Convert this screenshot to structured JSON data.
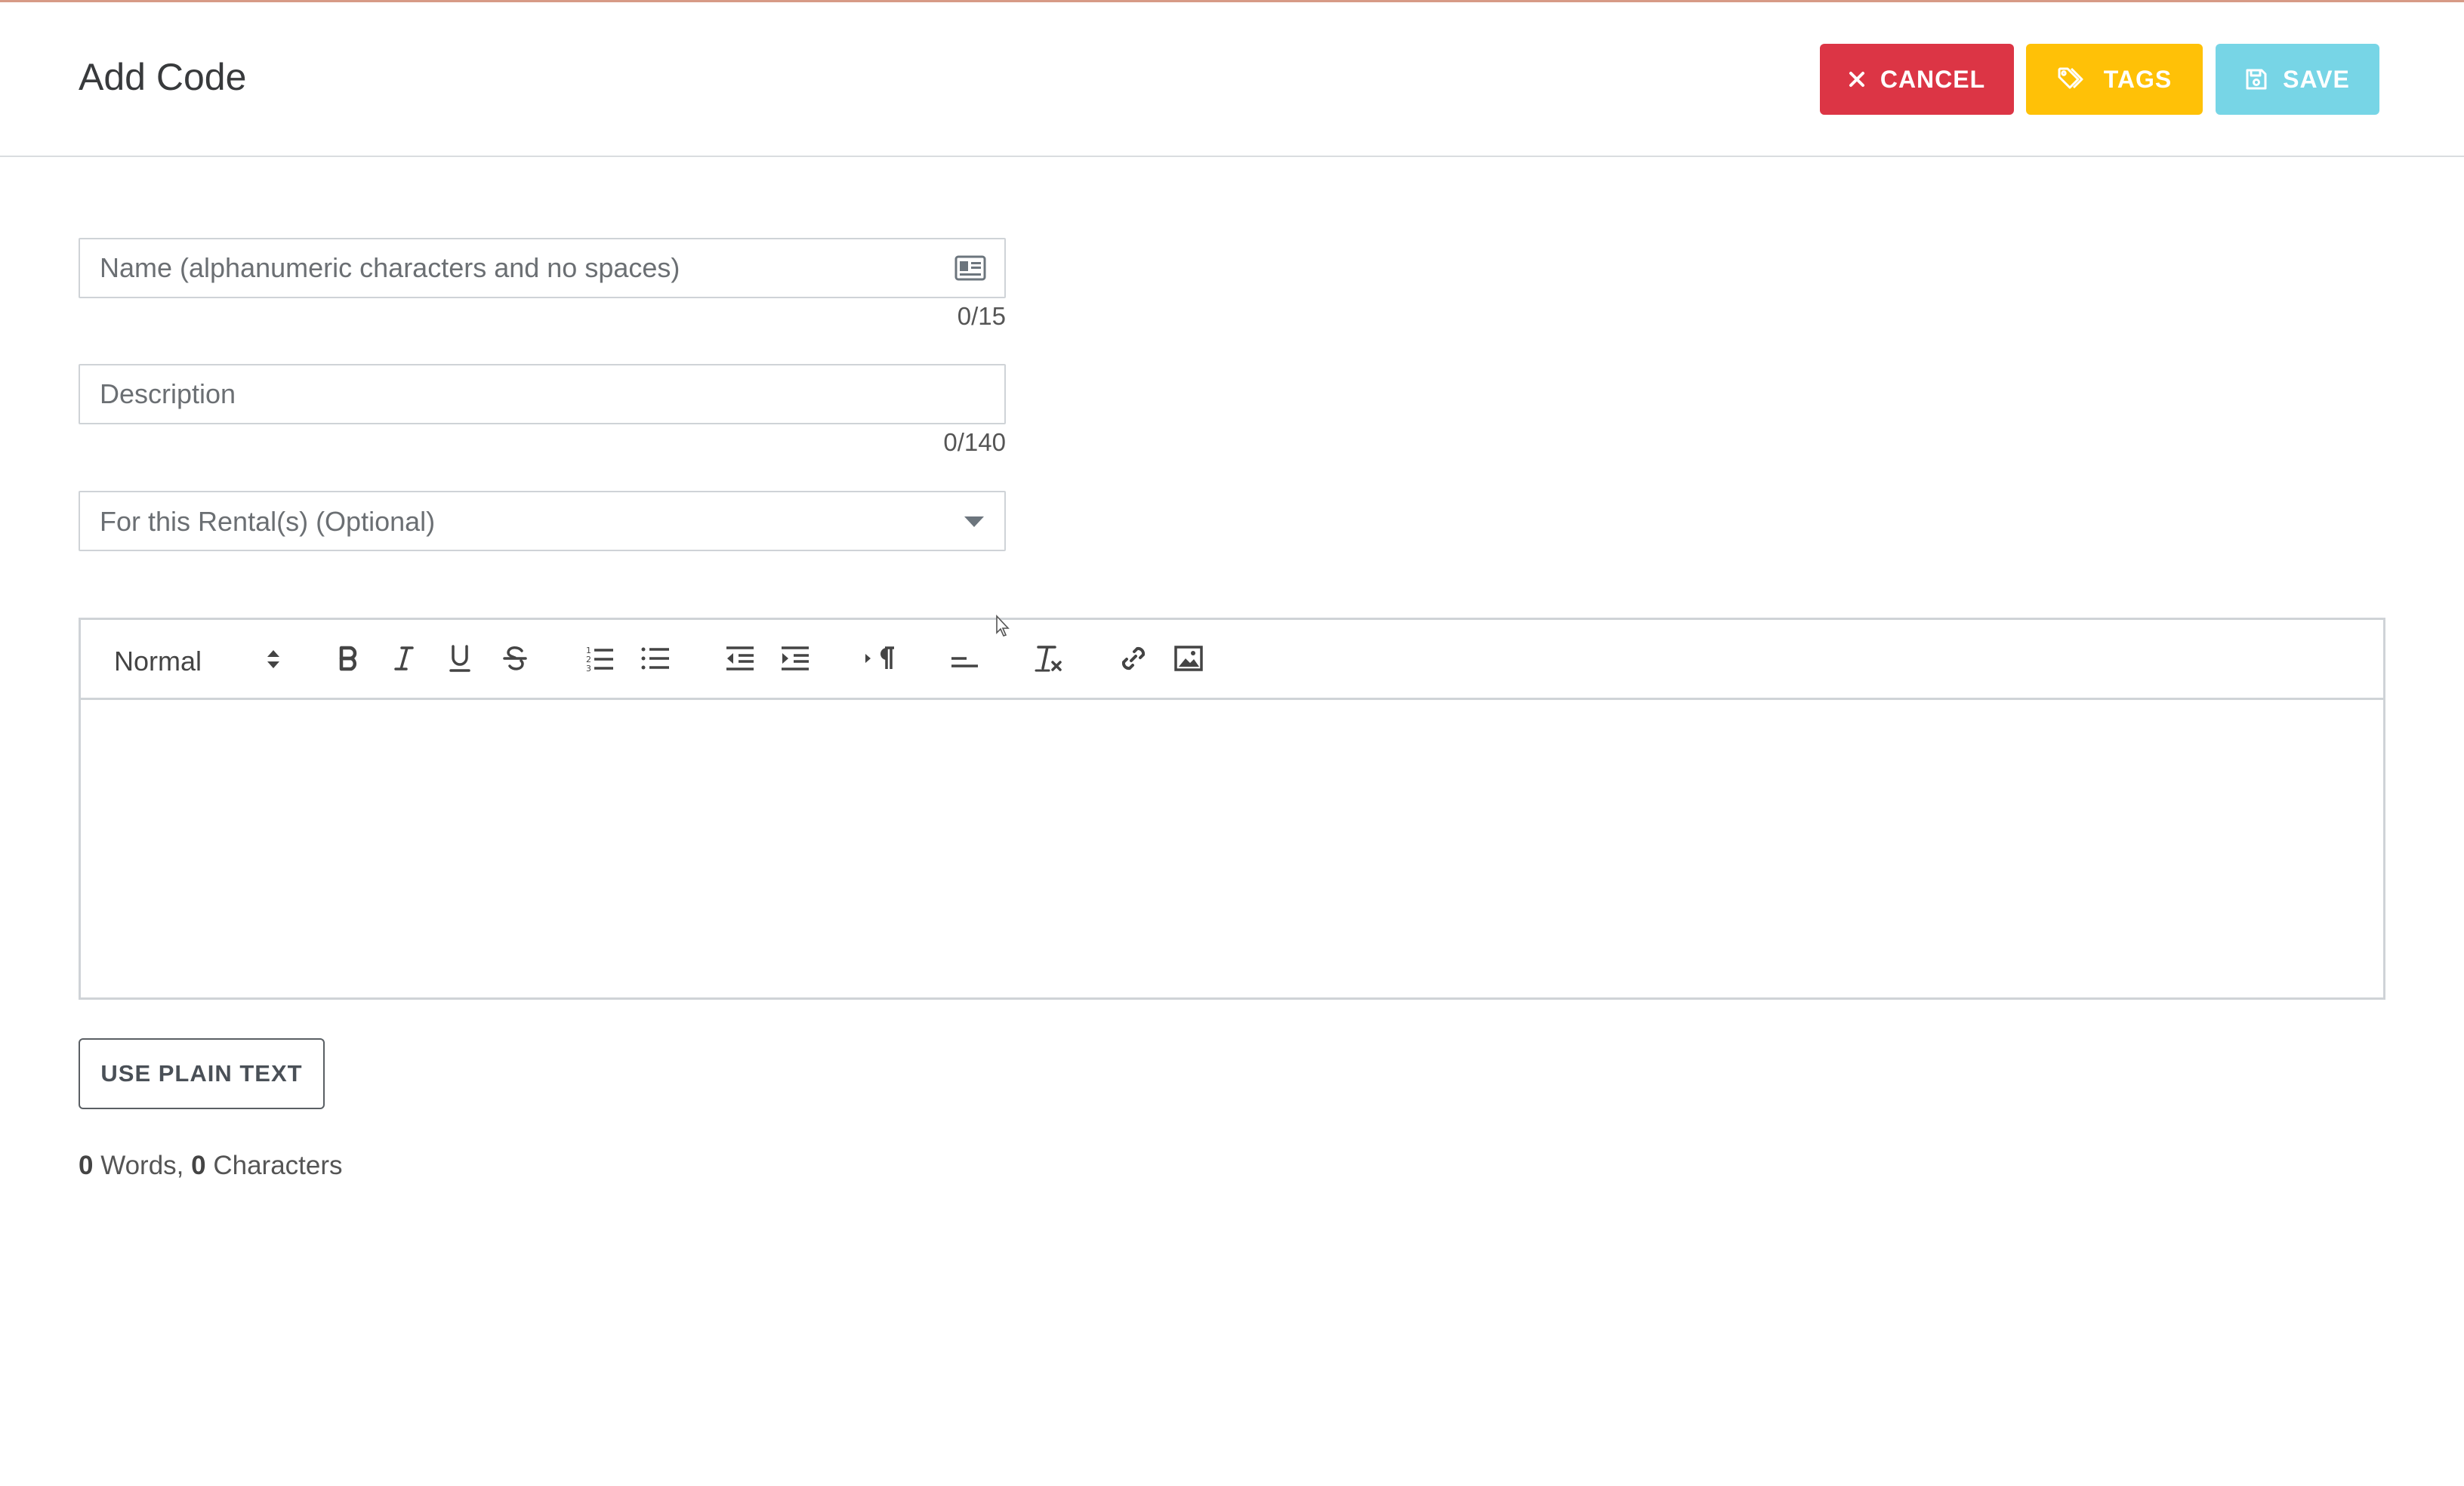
{
  "header": {
    "title": "Add Code",
    "cancel_label": "CANCEL",
    "tags_label": "TAGS",
    "save_label": "SAVE"
  },
  "form": {
    "name": {
      "placeholder": "Name (alphanumeric characters and no spaces)",
      "value": "",
      "counter": "0/15",
      "icon": "id-card-icon"
    },
    "description": {
      "placeholder": "Description",
      "value": "",
      "counter": "0/140"
    },
    "rental": {
      "placeholder": "For this Rental(s) (Optional)",
      "selected": ""
    }
  },
  "editor": {
    "format_value": "Normal",
    "toolbar_icons": [
      "bold-icon",
      "italic-icon",
      "underline-icon",
      "strikethrough-icon",
      "ordered-list-icon",
      "bullet-list-icon",
      "outdent-icon",
      "indent-icon",
      "text-direction-icon",
      "align-icon",
      "clear-format-icon",
      "link-icon",
      "image-icon"
    ],
    "content": ""
  },
  "footer": {
    "plain_text_label": "USE PLAIN TEXT",
    "word_count": "0",
    "words_label": " Words, ",
    "char_count": "0",
    "chars_label": " Characters"
  },
  "colors": {
    "cancel": "#dc3545",
    "tags": "#ffc107",
    "save": "#77d5e6"
  }
}
